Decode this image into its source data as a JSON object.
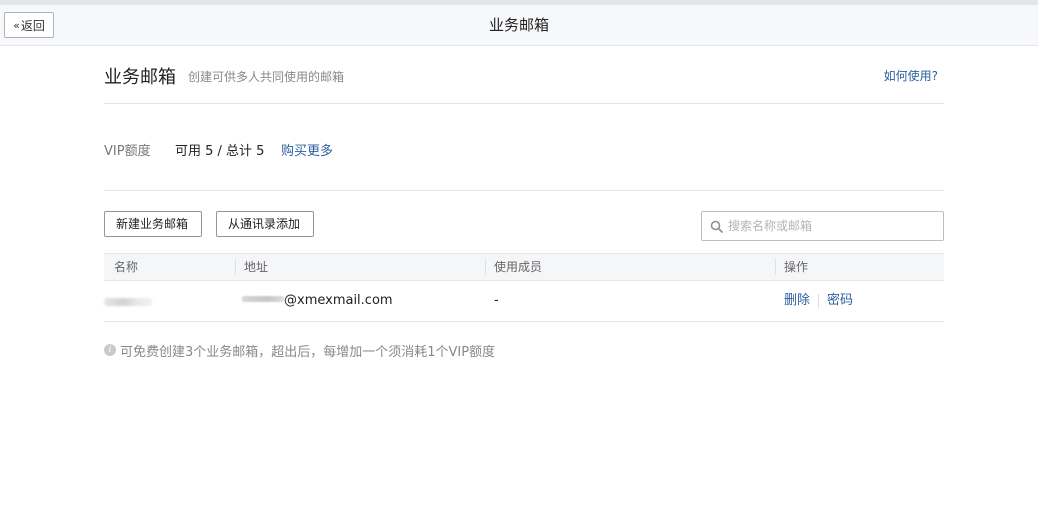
{
  "topbar": {
    "back_label": "返回",
    "back_icon": "double-chevron-left-icon",
    "title": "业务邮箱"
  },
  "header": {
    "title": "业务邮箱",
    "subtitle": "创建可供多人共同使用的邮箱",
    "help_link": "如何使用?"
  },
  "quota": {
    "label": "VIP额度",
    "value": "可用 5 / 总计 5",
    "buy_more": "购买更多"
  },
  "toolbar": {
    "new_button": "新建业务邮箱",
    "import_button": "从通讯录添加",
    "search_placeholder": "搜索名称或邮箱",
    "search_icon": "search-icon"
  },
  "table": {
    "columns": [
      "名称",
      "地址",
      "使用成员",
      "操作"
    ],
    "rows": [
      {
        "name": "",
        "address_suffix": "@xmexmail.com",
        "members": "-",
        "actions": [
          "删除",
          "密码"
        ]
      }
    ]
  },
  "note": {
    "icon": "info-icon",
    "text": "可免费创建3个业务邮箱，超出后，每增加一个须消耗1个VIP额度"
  },
  "colors": {
    "link": "#2b5f9e",
    "topbar_bg": "#f7f8fa",
    "table_header_bg": "#f5f6f8"
  }
}
